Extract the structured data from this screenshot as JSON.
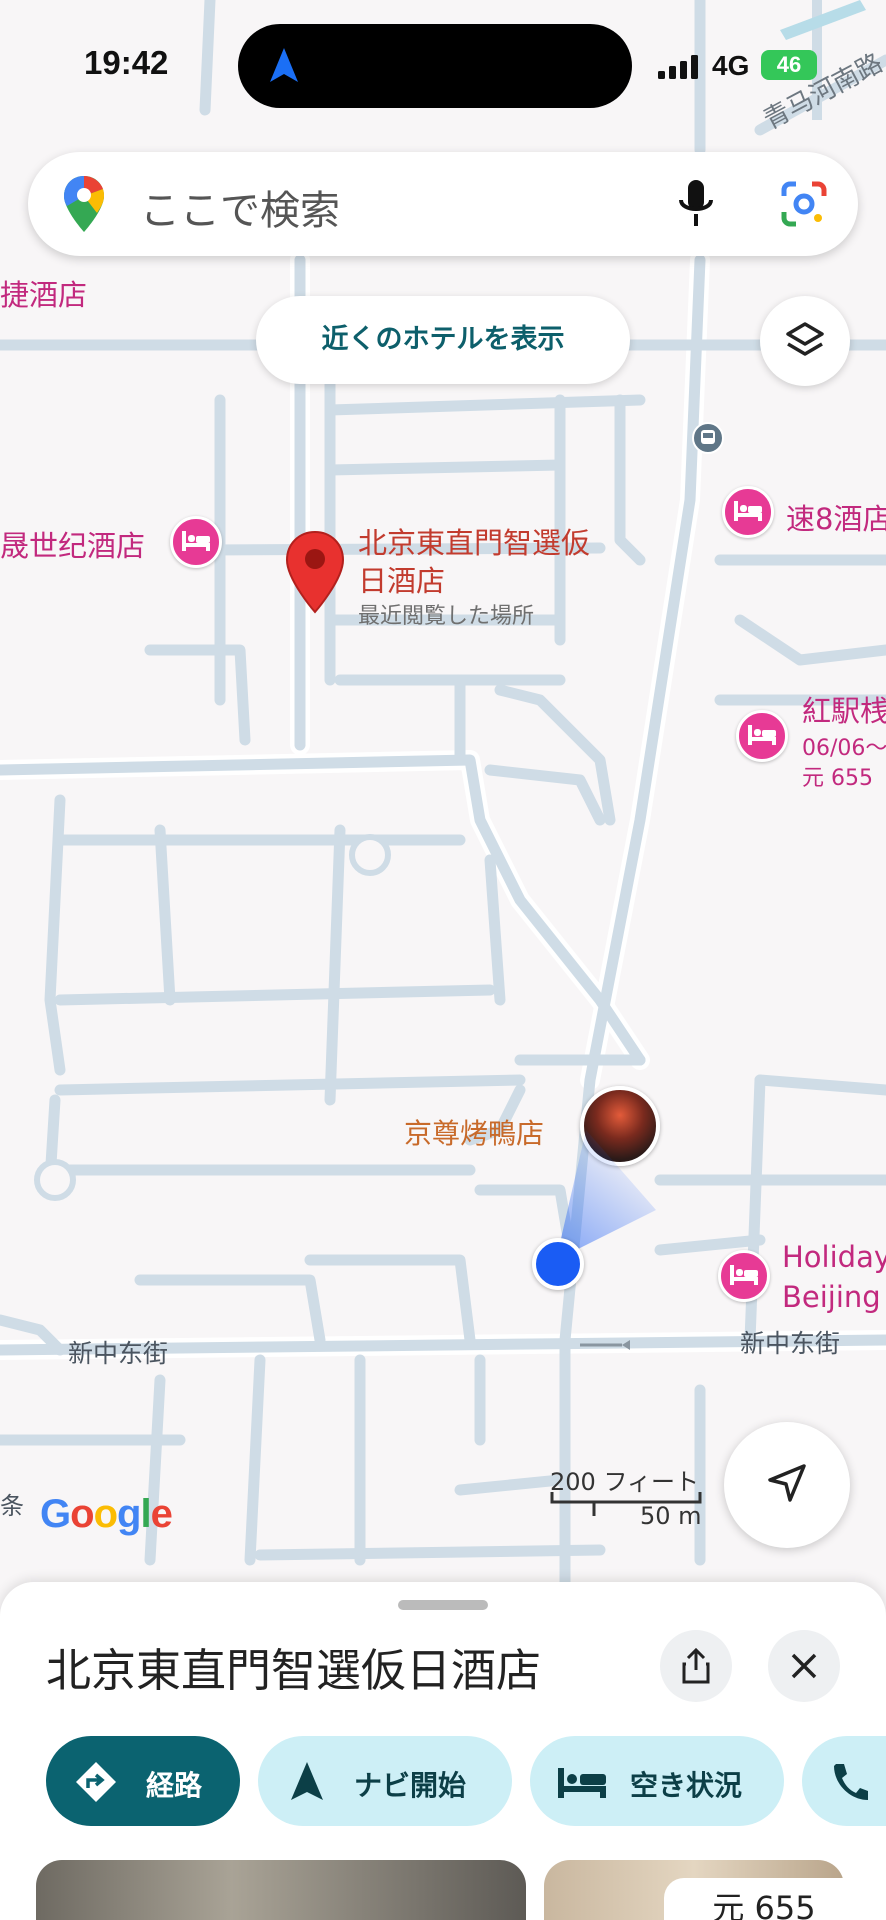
{
  "status_bar": {
    "time": "19:42",
    "network": "4G",
    "battery": "46"
  },
  "search": {
    "placeholder": "ここで検索",
    "icons": [
      "maps-pin-icon",
      "mic-icon",
      "google-lens-icon"
    ]
  },
  "map": {
    "chip_label": "近くのホテルを表示",
    "selected_pin": {
      "name": "北京東直門智選仮日酒店",
      "line1": "北京東直門智選仮",
      "line2": "日酒店",
      "subtitle": "最近閲覧した場所"
    },
    "labels": {
      "hotel_topleft": "捷酒店",
      "hotel_left": "晟世纪酒店",
      "hotel_right": "速8酒店",
      "hotel_hongzhan": "紅駅桟",
      "hotel_hongzhan_dates": "06/06〜",
      "hotel_hongzhan_price": "元 655",
      "restaurant": "京尊烤鴨店",
      "holiday_line1": "Holiday",
      "holiday_line2": "Beijing",
      "street_left": "新中东街",
      "street_right": "新中东街",
      "road_top": "青马河南路",
      "edge_left": "条"
    },
    "scale": {
      "feet": "200 フィート",
      "meters": "50 m"
    },
    "logo": [
      "G",
      "o",
      "o",
      "g",
      "l",
      "e"
    ],
    "colors": {
      "poi": "#e73a95",
      "pin": "#e8312f",
      "user": "#1a5cf4",
      "road": "#cfdce6"
    }
  },
  "sheet": {
    "title": "北京東直門智選仮日酒店",
    "actions": [
      {
        "label": "経路",
        "icon": "directions-icon"
      },
      {
        "label": "ナビ開始",
        "icon": "navigation-arrow-icon"
      },
      {
        "label": "空き状況",
        "icon": "bed-icon"
      },
      {
        "label": "",
        "icon": "phone-icon"
      }
    ],
    "price": "元 655"
  }
}
